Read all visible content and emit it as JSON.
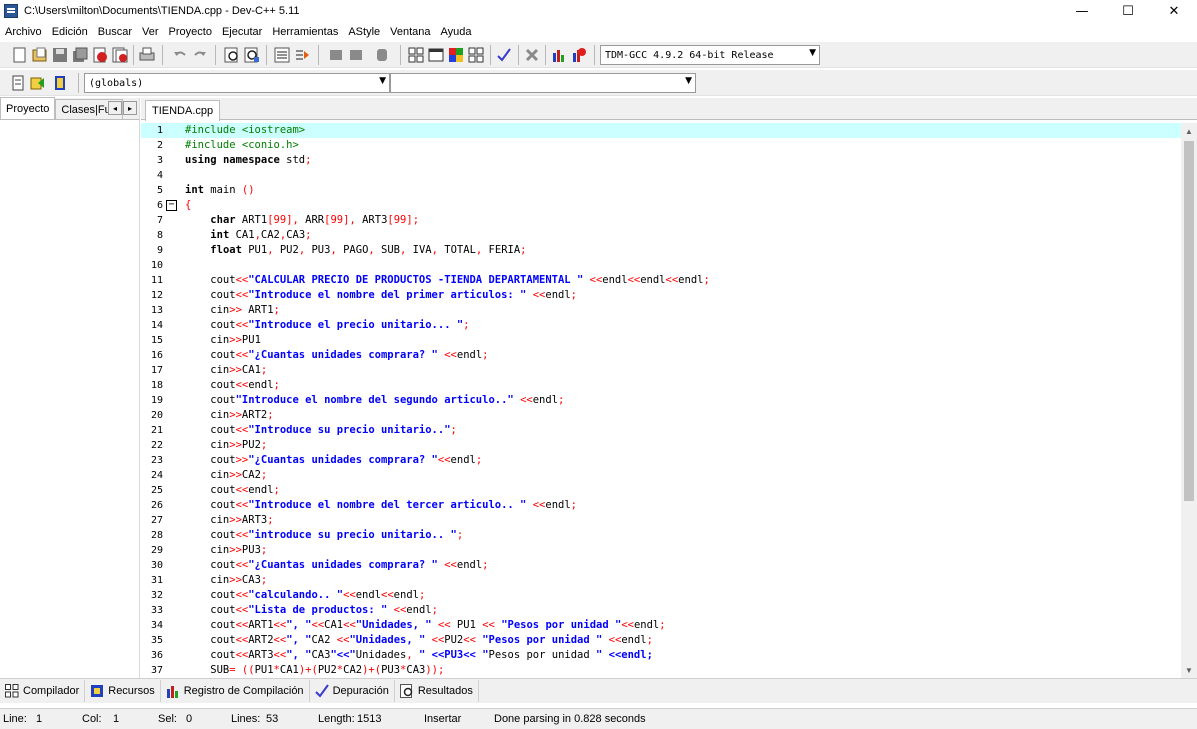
{
  "window": {
    "title": "C:\\Users\\milton\\Documents\\TIENDA.cpp - Dev-C++ 5.11",
    "minimize": "—",
    "maximize": "☐",
    "close": "✕"
  },
  "menu": [
    "Archivo",
    "Edición",
    "Buscar",
    "Ver",
    "Proyecto",
    "Ejecutar",
    "Herramientas",
    "AStyle",
    "Ventana",
    "Ayuda"
  ],
  "toolbar": {
    "compiler": "TDM-GCC 4.9.2 64-bit Release",
    "scope": "(globals)",
    "function": ""
  },
  "left_panel": {
    "tabs": [
      "Proyecto",
      "Clases|Fun"
    ]
  },
  "editor": {
    "tab": "TIENDA.cpp"
  },
  "code": [
    {
      "n": "1",
      "t": "#include <iostream>"
    },
    {
      "n": "2",
      "t": "#include <conio.h>"
    },
    {
      "n": "3",
      "t": "using namespace std;"
    },
    {
      "n": "4",
      "t": ""
    },
    {
      "n": "5",
      "t": "int main ()"
    },
    {
      "n": "6",
      "t": "{"
    },
    {
      "n": "7",
      "t": "    char ART1[99], ARR[99], ART3[99];"
    },
    {
      "n": "8",
      "t": "    int CA1,CA2,CA3;"
    },
    {
      "n": "9",
      "t": "    float PU1, PU2, PU3, PAGO, SUB, IVA, TOTAL, FERIA;"
    },
    {
      "n": "10",
      "t": ""
    },
    {
      "n": "11",
      "t": "    cout<<\"CALCULAR PRECIO DE PRODUCTOS -TIENDA DEPARTAMENTAL \" <<endl<<endl<<endl;"
    },
    {
      "n": "12",
      "t": "    cout<<\"Introduce el nombre del primer articulos: \" <<endl;"
    },
    {
      "n": "13",
      "t": "    cin>> ART1;"
    },
    {
      "n": "14",
      "t": "    cout<<\"Introduce el precio unitario... \";"
    },
    {
      "n": "15",
      "t": "    cin>>PU1"
    },
    {
      "n": "16",
      "t": "    cout<<\"¿Cuantas unidades comprara? \" <<endl;"
    },
    {
      "n": "17",
      "t": "    cin>>CA1;"
    },
    {
      "n": "18",
      "t": "    cout<<endl;"
    },
    {
      "n": "19",
      "t": "    cout\"Introduce el nombre del segundo articulo..\" <<endl;"
    },
    {
      "n": "20",
      "t": "    cin>>ART2;"
    },
    {
      "n": "21",
      "t": "    cout<<\"Introduce su precio unitario..\";"
    },
    {
      "n": "22",
      "t": "    cin>>PU2;"
    },
    {
      "n": "23",
      "t": "    cout>>\"¿Cuantas unidades comprara? \"<<endl;"
    },
    {
      "n": "24",
      "t": "    cin>>CA2;"
    },
    {
      "n": "25",
      "t": "    cout<<endl;"
    },
    {
      "n": "26",
      "t": "    cout<<\"Introduce el nombre del tercer articulo.. \" <<endl;"
    },
    {
      "n": "27",
      "t": "    cin>>ART3;"
    },
    {
      "n": "28",
      "t": "    cout<<\"introduce su precio unitario.. \";"
    },
    {
      "n": "29",
      "t": "    cin>>PU3;"
    },
    {
      "n": "30",
      "t": "    cout<<\"¿Cuantas unidades comprara? \" <<endl;"
    },
    {
      "n": "31",
      "t": "    cin>>CA3;"
    },
    {
      "n": "32",
      "t": "    cout<<\"calculando.. \"<<endl<<endl;"
    },
    {
      "n": "33",
      "t": "    cout<<\"Lista de productos: \" <<endl;"
    },
    {
      "n": "34",
      "t": "    cout<<ART1<<\", \"<<CA1<<\"Unidades, \" << PU1 << \"Pesos por unidad \"<<endl;"
    },
    {
      "n": "35",
      "t": "    cout<<ART2<<\", \"CA2 <<\"Unidades, \" <<PU2<< \"Pesos por unidad \" <<endl;"
    },
    {
      "n": "36",
      "t": "    cout<<ART3<<\", \"CA3\"<<\"Unidades, \" <<PU3<< \"Pesos por unidad \" <<endl;"
    },
    {
      "n": "37",
      "t": "    SUB= ((PU1*CA1)+(PU2*CA2)+(PU3*CA3));"
    }
  ],
  "bottom_tabs": [
    "Compilador",
    "Recursos",
    "Registro de Compilación",
    "Depuración",
    "Resultados"
  ],
  "status": {
    "line_label": "Line:",
    "line": "1",
    "col_label": "Col:",
    "col": "1",
    "sel_label": "Sel:",
    "sel": "0",
    "lines_label": "Lines:",
    "lines": "53",
    "length_label": "Length:",
    "length": "1513",
    "mode": "Insertar",
    "message": "Done parsing in 0.828 seconds"
  }
}
